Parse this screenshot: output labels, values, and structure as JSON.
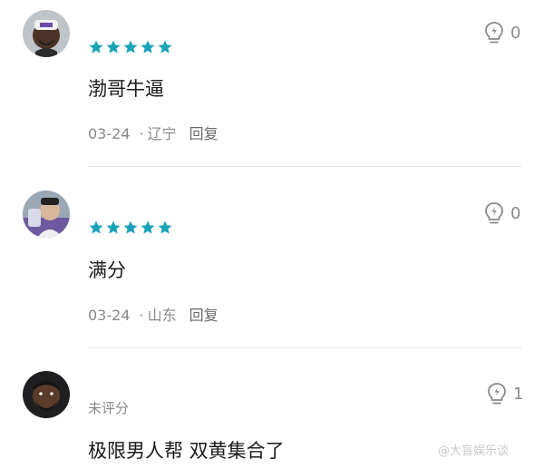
{
  "comments": [
    {
      "avatar_icon": "user-avatar-1",
      "rating_stars": 5,
      "text": "渤哥牛逼",
      "date": "03-24",
      "separator": "·",
      "location": "辽宁",
      "reply_label": "回复",
      "like_icon": "lightbulb-icon",
      "likes": "0"
    },
    {
      "avatar_icon": "user-avatar-2",
      "rating_stars": 5,
      "text": "满分",
      "date": "03-24",
      "separator": "·",
      "location": "山东",
      "reply_label": "回复",
      "like_icon": "lightbulb-icon",
      "likes": "0"
    },
    {
      "avatar_icon": "user-avatar-3",
      "rating_label": "未评分",
      "text": "极限男人帮 双黄集合了",
      "like_icon": "lightbulb-icon",
      "likes": "1"
    }
  ],
  "watermark": "@大盲娱乐谈",
  "colors": {
    "star": "#1aa3b8",
    "text": "#1a1a1a",
    "meta": "#8a8a8a",
    "divider": "#e6e6e6"
  }
}
